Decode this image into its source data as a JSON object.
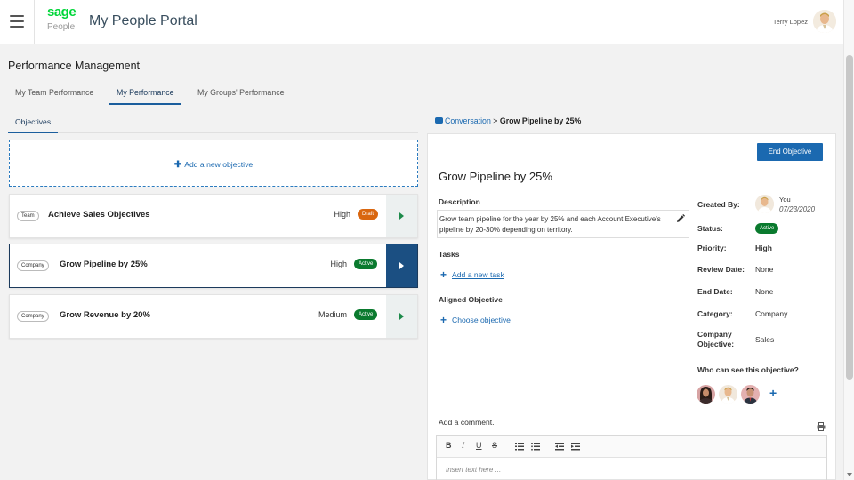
{
  "header": {
    "logo_top": "sage",
    "logo_bottom": "People",
    "title": "My People Portal",
    "user_name": "Terry Lopez"
  },
  "page": {
    "title": "Performance Management",
    "tabs": [
      {
        "label": "My Team Performance",
        "active": false
      },
      {
        "label": "My Performance",
        "active": true
      },
      {
        "label": "My Groups' Performance",
        "active": false
      }
    ],
    "sub_tab": "Objectives"
  },
  "objectives": {
    "add_label": "Add a new objective",
    "items": [
      {
        "type": "Team",
        "name": "Achieve Sales Objectives",
        "priority": "High",
        "status": "Draft",
        "status_color": "#d9660f",
        "selected": false
      },
      {
        "type": "Company",
        "name": "Grow Pipeline by 25%",
        "priority": "High",
        "status": "Active",
        "status_color": "#0a7a2e",
        "selected": true
      },
      {
        "type": "Company",
        "name": "Grow Revenue by 20%",
        "priority": "Medium",
        "status": "Active",
        "status_color": "#0a7a2e",
        "selected": false
      }
    ]
  },
  "breadcrumb": {
    "link": "Conversation",
    "separator": ">",
    "current": "Grow Pipeline by 25%"
  },
  "detail": {
    "end_button": "End Objective",
    "title": "Grow Pipeline by 25%",
    "description_label": "Description",
    "description": "Grow team pipeline for the year by 25% and each Account Executive's pipeline by 20-30% depending on territory.",
    "tasks_label": "Tasks",
    "add_task": "Add a new task",
    "aligned_label": "Aligned Objective",
    "choose_objective": "Choose objective",
    "created_by_label": "Created By:",
    "created_by": "You",
    "created_date": "07/23/2020",
    "status_label": "Status:",
    "status": "Active",
    "priority_label": "Priority:",
    "priority": "High",
    "review_label": "Review Date:",
    "review": "None",
    "end_label": "End Date:",
    "end": "None",
    "category_label": "Category:",
    "category": "Company",
    "company_obj_label_1": "Company",
    "company_obj_label_2": "Objective:",
    "company_obj": "Sales",
    "who_label": "Who can see this objective?",
    "comment_label": "Add a comment.",
    "editor_placeholder": "Insert text here ..."
  },
  "colors": {
    "brand_green": "#00d639",
    "primary_blue": "#1b69b0",
    "selected_navy": "#1b4f82",
    "active_green": "#0a7a2e",
    "draft_orange": "#d9660f"
  },
  "icons": [
    "hamburger-menu-icon",
    "chat-bubble-icon",
    "pencil-icon",
    "plus-icon",
    "print-icon",
    "chevron-right-icon"
  ]
}
